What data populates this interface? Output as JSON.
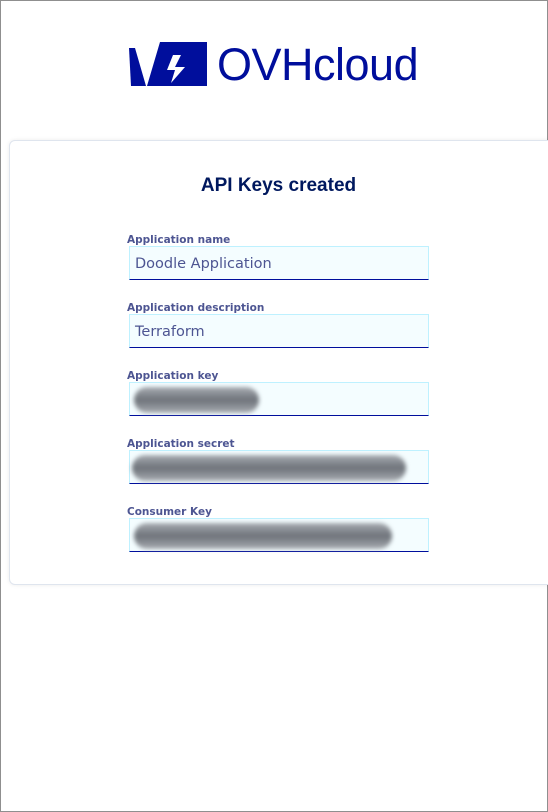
{
  "brand": {
    "name": "OVHcloud",
    "color": "#000e9c"
  },
  "card": {
    "title": "API Keys created",
    "fields": [
      {
        "label": "Application name",
        "value": "Doodle Application",
        "redacted": false
      },
      {
        "label": "Application description",
        "value": "Terraform",
        "redacted": false
      },
      {
        "label": "Application key",
        "value": "",
        "redacted": true
      },
      {
        "label": "Application secret",
        "value": "",
        "redacted": true
      },
      {
        "label": "Consumer Key",
        "value": "",
        "redacted": true
      }
    ]
  }
}
